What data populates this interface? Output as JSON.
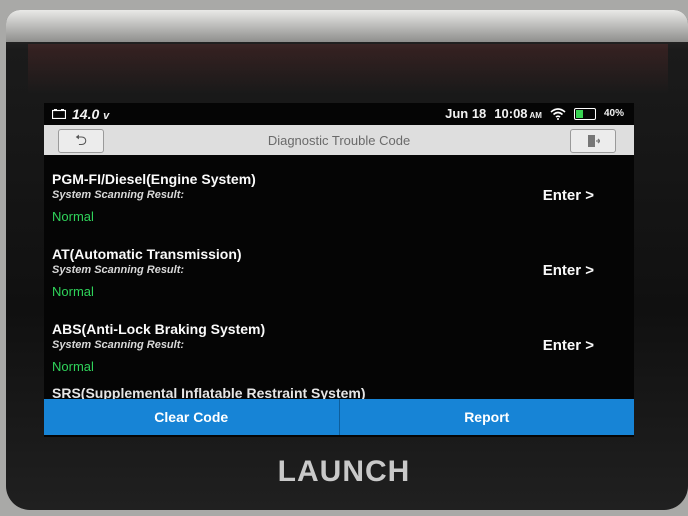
{
  "status_bar": {
    "voltage": "14.0",
    "voltage_unit": "v",
    "date": "Jun 18",
    "time": "10:08",
    "ampm": "AM",
    "battery": "40%"
  },
  "header": {
    "title": "Diagnostic Trouble Code",
    "back_icon": "back-arrow-icon",
    "exit_icon": "exit-door-icon"
  },
  "systems": [
    {
      "name": "PGM-FI/Diesel(Engine System)",
      "scan_label": "System Scanning Result:",
      "result": "Normal",
      "action": "Enter >"
    },
    {
      "name": "AT(Automatic Transmission)",
      "scan_label": "System Scanning Result:",
      "result": "Normal",
      "action": "Enter >"
    },
    {
      "name": "ABS(Anti-Lock Braking System)",
      "scan_label": "System Scanning Result:",
      "result": "Normal",
      "action": "Enter >"
    },
    {
      "name": "SRS(Supplemental Inflatable Restraint System)"
    }
  ],
  "footer": {
    "clear_code": "Clear Code",
    "report": "Report"
  },
  "device": {
    "brand": "LAUNCH"
  },
  "colors": {
    "accent": "#1784d6",
    "normal": "#2fd35a"
  }
}
